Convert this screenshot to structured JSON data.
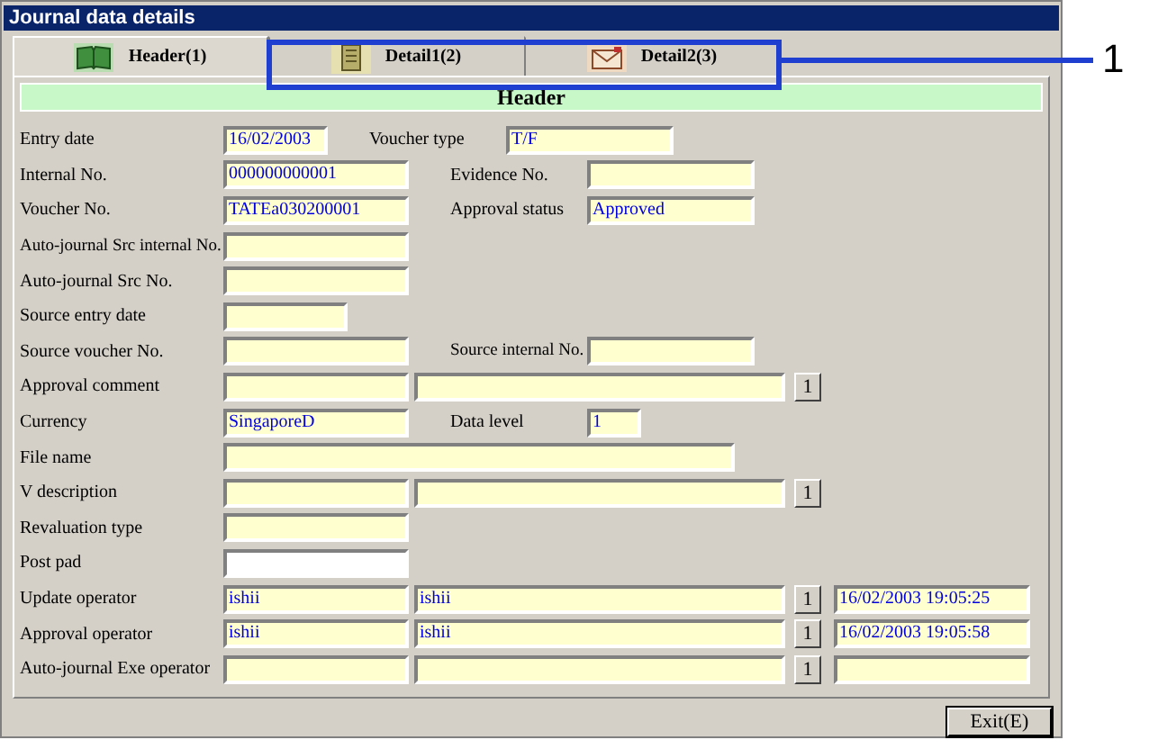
{
  "window": {
    "title": "Journal data details"
  },
  "tabs": [
    {
      "label": "Header(1)",
      "selected": true
    },
    {
      "label": "Detail1(2)",
      "selected": false
    },
    {
      "label": "Detail2(3)",
      "selected": false
    }
  ],
  "section_title": "Header",
  "rows": [
    {
      "kind": "pair",
      "label": "Entry date",
      "fields": [
        {
          "value": "16/02/2003",
          "editable": false
        },
        {
          "value": "T/F",
          "editable": false
        }
      ],
      "label2": "Voucher type"
    },
    {
      "kind": "pair",
      "label": "Internal No.",
      "fields": [
        {
          "value": "000000000001",
          "editable": false
        },
        {
          "editable": false
        }
      ],
      "label2": "Evidence No."
    },
    {
      "kind": "pair",
      "label": "Voucher No.",
      "fields": [
        {
          "value": "TATEa030200001",
          "editable": false
        },
        {
          "value": "Approved",
          "editable": false
        }
      ],
      "label2": "Approval status"
    },
    {
      "kind": "single",
      "label": "Auto-journal Src internal No.",
      "fields": [
        {
          "editable": false
        }
      ]
    },
    {
      "kind": "single",
      "label": "Auto-journal Src No.",
      "fields": [
        {
          "editable": false
        }
      ]
    },
    {
      "kind": "single",
      "label": "Source entry date",
      "fields": [
        {
          "editable": false
        }
      ]
    },
    {
      "kind": "pair",
      "label": "Source voucher No.",
      "fields": [
        {
          "editable": false
        },
        {
          "editable": false
        }
      ],
      "label2": "Source internal No."
    },
    {
      "kind": "note",
      "label": "Approval comment",
      "fields": [
        {
          "editable": false
        },
        {
          "editable": false
        }
      ],
      "button": "1"
    },
    {
      "kind": "pair",
      "label": "Currency",
      "fields": [
        {
          "value": "SingaporeD",
          "editable": false
        },
        {
          "value": "1",
          "editable": false
        }
      ],
      "label2": "Data level"
    },
    {
      "kind": "single",
      "label": "File name",
      "fields": [
        {
          "editable": false
        }
      ]
    },
    {
      "kind": "note",
      "label": "V description",
      "fields": [
        {
          "editable": false
        },
        {
          "editable": false
        }
      ],
      "button": "1"
    },
    {
      "kind": "single",
      "label": "Revaluation type",
      "fields": [
        {
          "editable": false
        }
      ]
    },
    {
      "kind": "single",
      "label": "Post pad",
      "fields": [
        {
          "editable": true
        }
      ]
    },
    {
      "kind": "operator",
      "label": "Update operator",
      "fields": [
        {
          "value": "ishii",
          "editable": false
        },
        {
          "value": "ishii",
          "editable": false
        },
        {
          "value": "16/02/2003 19:05:25",
          "editable": false
        }
      ],
      "button": "1"
    },
    {
      "kind": "operator",
      "label": "Approval operator",
      "fields": [
        {
          "value": "ishii",
          "editable": false
        },
        {
          "value": "ishii",
          "editable": false
        },
        {
          "value": "16/02/2003 19:05:58",
          "editable": false
        }
      ],
      "button": "1"
    },
    {
      "kind": "operator",
      "label": "Auto-journal Exe operator",
      "fields": [
        {
          "editable": false
        },
        {
          "editable": false
        },
        {
          "editable": false
        }
      ],
      "button": "1"
    }
  ],
  "exit_button": "Exit(E)",
  "callout": {
    "label": "1"
  }
}
